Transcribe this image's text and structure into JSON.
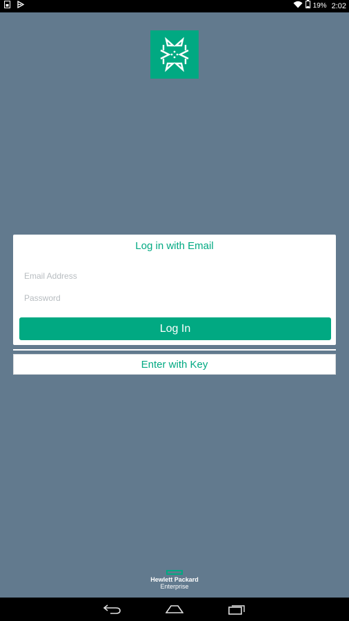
{
  "status_bar": {
    "battery_percent": "19%",
    "time": "2:02",
    "icons": [
      "sim-card-icon",
      "notification-icon",
      "wifi-icon",
      "battery-icon"
    ]
  },
  "app": {
    "logo_icon": "app-logo-icon",
    "accent_color": "#01a982",
    "background_color": "#627a8e"
  },
  "login": {
    "title": "Log in with Email",
    "email_placeholder": "Email Address",
    "email_value": "",
    "password_placeholder": "Password",
    "password_value": "",
    "login_button": "Log In"
  },
  "key_button": "Enter with Key",
  "brand": {
    "line1": "Hewlett Packard",
    "line2": "Enterprise"
  },
  "nav_bar": {
    "icons": [
      "back-icon",
      "home-icon",
      "recents-icon"
    ]
  }
}
